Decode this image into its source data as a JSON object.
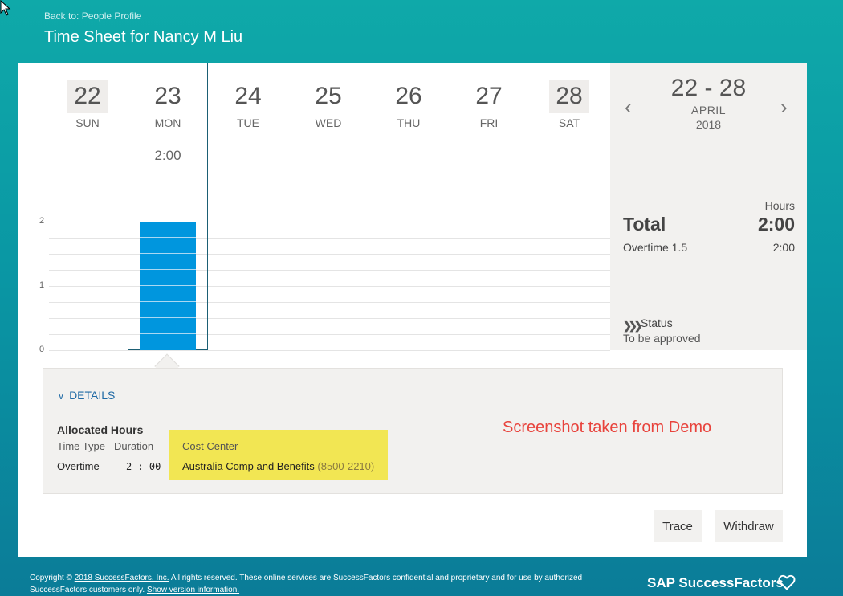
{
  "header": {
    "back_link": "Back to: People Profile",
    "title": "Time Sheet for Nancy M Liu"
  },
  "week": {
    "days": [
      {
        "num": "22",
        "name": "SUN",
        "hours": ""
      },
      {
        "num": "23",
        "name": "MON",
        "hours": "2:00"
      },
      {
        "num": "24",
        "name": "TUE",
        "hours": ""
      },
      {
        "num": "25",
        "name": "WED",
        "hours": ""
      },
      {
        "num": "26",
        "name": "THU",
        "hours": ""
      },
      {
        "num": "27",
        "name": "FRI",
        "hours": ""
      },
      {
        "num": "28",
        "name": "SAT",
        "hours": ""
      }
    ],
    "y_axis": [
      "2",
      "1",
      "0"
    ]
  },
  "chart_data": {
    "type": "bar",
    "categories": [
      "SUN",
      "MON",
      "TUE",
      "WED",
      "THU",
      "FRI",
      "SAT"
    ],
    "values": [
      0,
      2,
      0,
      0,
      0,
      0,
      0
    ],
    "ylim": [
      0,
      2
    ],
    "yticks": [
      0,
      1,
      2
    ],
    "grid": true,
    "bar_color": "#0096de"
  },
  "summary": {
    "range": "22 - 28",
    "month": "APRIL",
    "year": "2018",
    "hours_label": "Hours",
    "total_label": "Total",
    "total_value": "2:00",
    "overtime_label": "Overtime 1.5",
    "overtime_value": "2:00",
    "status_label": "Status",
    "status_value": "To be approved"
  },
  "details": {
    "toggle_label": "DETAILS",
    "allocated_title": "Allocated Hours",
    "col_time_type": "Time Type",
    "col_duration": "Duration",
    "col_cost_center": "Cost Center",
    "row_time_type": "Overtime",
    "row_duration": "2 : 00",
    "row_cost_center": "Australia Comp and Benefits",
    "row_cost_center_code": "(8500-2210)",
    "watermark": "Screenshot taken from Demo"
  },
  "actions": {
    "trace": "Trace",
    "withdraw": "Withdraw"
  },
  "footer": {
    "copyright_prefix": "Copyright ©",
    "company_link": "2018 SuccessFactors, Inc.",
    "rights_text": "All rights reserved. These online services are SuccessFactors confidential and proprietary and for use by authorized SuccessFactors customers only.",
    "version_link": "Show version information.",
    "brand": "SAP SuccessFactors"
  },
  "colors": {
    "accent": "#0096de",
    "link": "#1f6aa5",
    "highlight": "#f2e653",
    "watermark": "#e8433c"
  }
}
